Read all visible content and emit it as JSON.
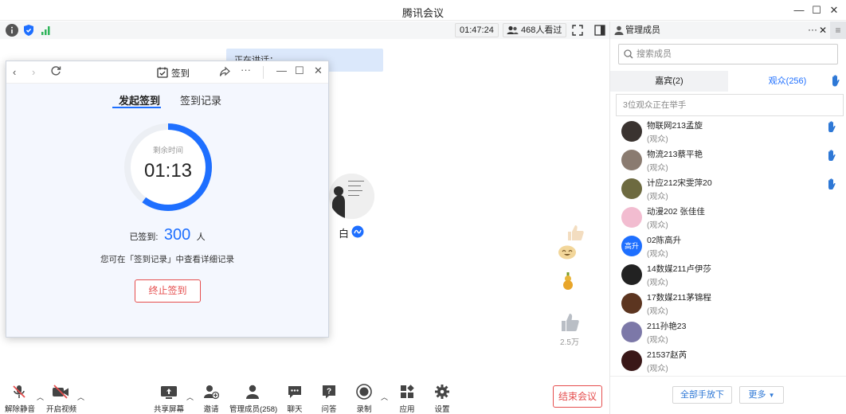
{
  "window": {
    "title": "腾讯会议"
  },
  "infobar": {
    "duration": "01:47:24",
    "viewers": "468人看过"
  },
  "speaking": {
    "text": "正在讲话："
  },
  "video": {
    "name": "白"
  },
  "reactions": {
    "like_count": "2.5万"
  },
  "popup": {
    "title": "签到",
    "tab_start": "发起签到",
    "tab_records": "签到记录",
    "remaining_label": "剩余时间",
    "remaining_time": "01:13",
    "remaining_fraction": 0.6,
    "signed_label": "已签到:",
    "signed_count": "300",
    "signed_unit": "人",
    "hint": "您可在「签到记录」中查看详细记录",
    "stop_button": "终止签到"
  },
  "toolbar": {
    "unmute": "解除静音",
    "start_video": "开启视频",
    "share_screen": "共享屏幕",
    "invite": "邀请",
    "manage_members": "管理成员(258)",
    "chat": "聊天",
    "qa": "问答",
    "record": "录制",
    "apps": "应用",
    "settings": "设置",
    "end_meeting": "结束会议"
  },
  "panel": {
    "title": "管理成员",
    "search_placeholder": "搜索成员",
    "tab_guests": "嘉宾(2)",
    "tab_audience": "观众(256)",
    "hand_notice": "3位观众正在举手",
    "members": [
      {
        "name": "物联网213孟旋",
        "role": "(观众)",
        "hand": true,
        "avatar_color": "#3a3330"
      },
      {
        "name": "物流213蔡平艳",
        "role": "(观众)",
        "hand": true,
        "avatar_color": "#8a7b70"
      },
      {
        "name": "计应212宋雯萍20",
        "role": "(观众)",
        "hand": true,
        "avatar_color": "#6d6a40"
      },
      {
        "name": " 动漫202 张佳佳",
        "role": "(观众)",
        "hand": false,
        "avatar_color": "#f2bcd0"
      },
      {
        "name": "02陈高升",
        "role": "(观众)",
        "hand": false,
        "avatar_color": "#1e6fff",
        "avatar_text": "高升"
      },
      {
        "name": "14数媒211卢伊莎",
        "role": "(观众)",
        "hand": false,
        "avatar_color": "#222222"
      },
      {
        "name": "17数媒211茅锦程",
        "role": "(观众)",
        "hand": false,
        "avatar_color": "#5c3520"
      },
      {
        "name": "211孙艳23",
        "role": "(观众)",
        "hand": false,
        "avatar_color": "#7c78a8"
      },
      {
        "name": "21537赵芮",
        "role": "(观众)",
        "hand": false,
        "avatar_color": "#3a1818"
      }
    ],
    "lower_all_hands": "全部手放下",
    "more": "更多"
  },
  "colors": {
    "accent": "#1e6fff",
    "danger": "#e54d4d",
    "hand": "#2e78d6"
  }
}
